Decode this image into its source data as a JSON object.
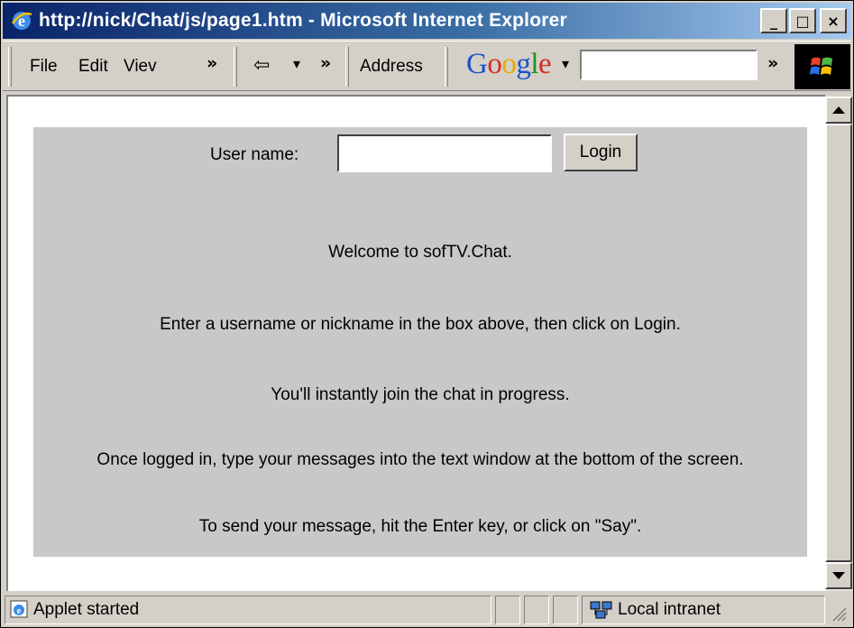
{
  "window": {
    "title": "http://nick/Chat/js/page1.htm - Microsoft Internet Explorer",
    "controls": {
      "minimize": "_",
      "maximize": "□",
      "close": "×"
    }
  },
  "toolbar": {
    "menu": [
      "File",
      "Edit",
      "Viev"
    ],
    "overflow": "»",
    "back_arrow": "⇦",
    "dropdown_arrow": "▾",
    "address_label": "Address",
    "google": {
      "letters": [
        "G",
        "o",
        "o",
        "g",
        "l",
        "e"
      ],
      "colors": [
        "#1a53c8",
        "#d62d20",
        "#e8a900",
        "#1a53c8",
        "#22901e",
        "#d62d20"
      ],
      "dropdown": "▾"
    }
  },
  "chat": {
    "username_label": "User name:",
    "username_value": "",
    "login_button": "Login",
    "messages": [
      "Welcome to sofTV.Chat.",
      "Enter a username or nickname in the box above, then click on Login.",
      "You'll instantly join the chat in progress.",
      "Once logged in, type your messages into the text window at the bottom of the screen.",
      "To send your message, hit the Enter key, or click on \"Say\"."
    ]
  },
  "status": {
    "left_text": "Applet started",
    "zone_text": "Local intranet"
  },
  "colors": {
    "title_bar": "#0a246a",
    "panel_bg": "#c8c8c8",
    "chrome": "#d4d0c8"
  }
}
